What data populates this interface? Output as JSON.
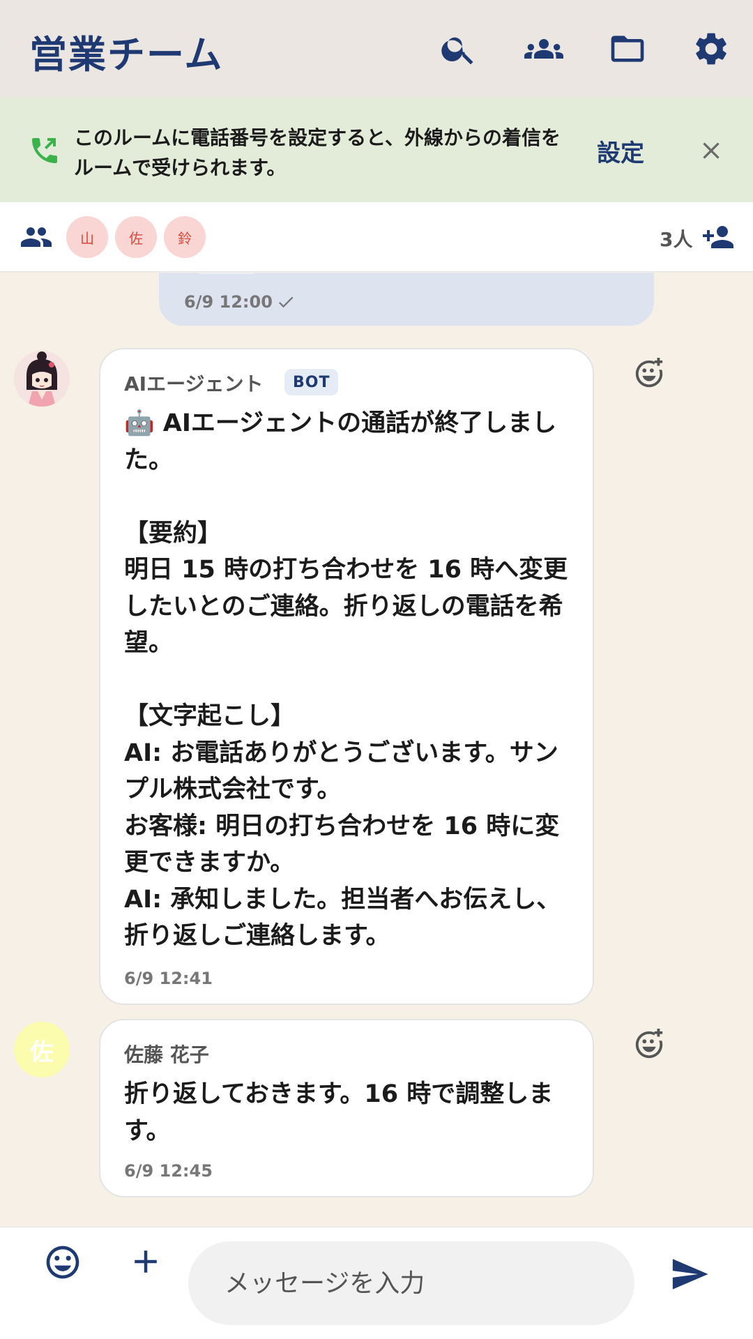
{
  "header": {
    "title": "営業チーム",
    "icons": [
      "search-icon",
      "group-icon",
      "folder-icon",
      "gear-icon"
    ]
  },
  "banner": {
    "text": "このルームに電話番号を設定すると、外線からの着信をルームで受けられます。",
    "action_label": "設定",
    "icon": "phone-forward-icon"
  },
  "members": {
    "avatars": [
      "山",
      "佐",
      "鈴"
    ],
    "count": "3人"
  },
  "messages": {
    "previous": {
      "time": "6/9 12:00"
    },
    "bot": {
      "sender": "AIエージェント",
      "badge": "BOT",
      "body": "🤖 AIエージェントの通話が終了しました。\n\n【要約】\n明日 15 時の打ち合わせを 16 時へ変更したいとのご連絡。折り返しの電話を希望。\n\n【文字起こし】\nAI: お電話ありがとうございます。サンプル株式会社です。\nお客様: 明日の打ち合わせを 16 時に変更できますか。\nAI: 承知しました。担当者へお伝えし、折り返しご連絡します。",
      "time": "6/9 12:41"
    },
    "user": {
      "avatar": "佐",
      "sender": "佐藤 花子",
      "body": "折り返しておきます。16 時で調整します。",
      "time": "6/9 12:45"
    }
  },
  "composer": {
    "placeholder": "メッセージを入力"
  },
  "colors": {
    "primary": "#1f3a73",
    "header_bg": "#ebe6e1",
    "banner_bg": "#e3ecd9",
    "chat_bg": "#f6f0e7",
    "phone_green": "#3bb24a"
  }
}
